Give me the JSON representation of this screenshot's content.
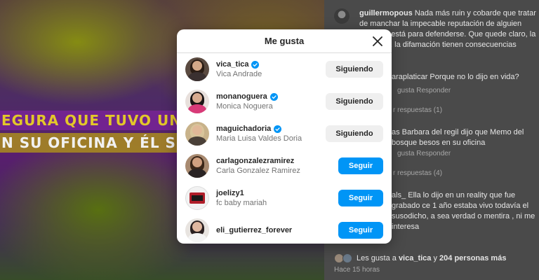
{
  "video": {
    "caption_line_1": "EGURA QUE TUVO UNA CI",
    "caption_line_2": "N SU OFICINA Y ÉL SE L"
  },
  "comments": {
    "items": [
      {
        "username": "guillermopous",
        "text": "Nada más ruin y cobarde que tratar de manchar la impecable reputación de alguien quien no está para defenderse. Que quede claro, la calumnia, la difamación tienen consecuencias legales..."
      },
      {
        "text_fragment": "araplaticar Porque no lo dijo en vida?",
        "actions": "gusta   Responder",
        "replies": "r respuestas (1)"
      },
      {
        "text_fragment": "as Barbara del regil dijo que Memo del bosque besos en su oficina",
        "actions": "gusta   Responder",
        "replies": "r respuestas (4)"
      },
      {
        "text_fragment": "als_ Ella lo dijo en un reality que fue grabado ce 1 año estaba vivo todavía el susodicho, a sea verdad o mentira , ni me interesa"
      }
    ],
    "likes_prefix": "Les gusta a",
    "likes_user": "vica_tica",
    "likes_middle": "y",
    "likes_others": "204 personas más",
    "timestamp": "Hace 15 horas"
  },
  "modal": {
    "title": "Me gusta",
    "users": [
      {
        "handle": "vica_tica",
        "name": "Vica Andrade",
        "verified": true,
        "button": "Siguiendo",
        "following": true
      },
      {
        "handle": "monanoguera",
        "name": "Monica Noguera",
        "verified": true,
        "button": "Siguiendo",
        "following": true
      },
      {
        "handle": "maguichadoria",
        "name": "Maria Luisa Valdes Doria",
        "verified": true,
        "button": "Siguiendo",
        "following": true
      },
      {
        "handle": "carlagonzalezramirez",
        "name": "Carla Gonzalez Ramirez",
        "verified": false,
        "button": "Seguir",
        "following": false
      },
      {
        "handle": "joelizy1",
        "name": "fc baby mariah",
        "verified": false,
        "button": "Seguir",
        "following": false
      },
      {
        "handle": "eli_gutierrez_forever",
        "name": "",
        "verified": false,
        "button": "Seguir",
        "following": false
      }
    ]
  },
  "colors": {
    "follow_blue": "#0095f6",
    "following_gray": "#efefef",
    "verified_blue": "#0095f6"
  },
  "icons": {
    "close": "close-icon",
    "verified": "verified-badge-icon"
  }
}
